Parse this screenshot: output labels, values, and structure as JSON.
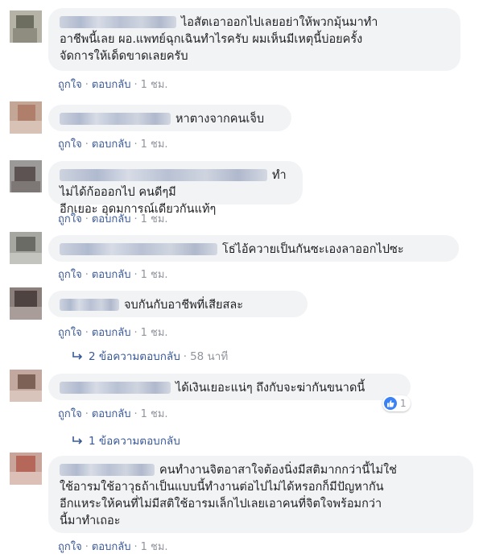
{
  "actions": {
    "like": "ถูกใจ",
    "reply": "ตอบกลับ",
    "separator": "·"
  },
  "comments": [
    {
      "text": "ไอสัตเอาออกไปเลยอย่าให้พวกมุ้นมาทำ\nอาชีพนี้เลย ผอ.แพทย์ฉุกเฉินทำไรครับ ผมเห็นมีเหตุนี้บ่อยครั้ง\nจัดการให้เด็ดขาดเลยครับ",
      "time": "1 ชม."
    },
    {
      "text": "หาตางจากคนเจ็บ",
      "time": "1 ชม."
    },
    {
      "text": "ทำไม่ได้ก้อออกไป คนดีๆมี\nอีกเยอะ อุดมการณ์เดียวกันแท้ๆ",
      "time": "1 ชม."
    },
    {
      "text": "โธ่ไอ้ควายเป็นกันซะเองลาออกไปซะ",
      "time": "1 ชม."
    },
    {
      "text": "จบกันกับอาชีพที่เสียสละ",
      "time": "1 ชม.",
      "replies": "2 ข้อความตอบกลับ",
      "replies_time": "58 นาที"
    },
    {
      "text": "ได้เงินเยอะแน่ๆ ถึงกับจะฆ่ากันขนาดนี้",
      "time": "1 ชม.",
      "replies": "1 ข้อความตอบกลับ",
      "reaction_count": "1"
    },
    {
      "text": "คนทำงานจิตอาสาใจต้องนิ่งมีสติมากกว่านี้ไม่ใช่\nใช้อารมใช้อาวุธถ้าเป็นแบบนี้ทำงานต่อไปไม่ได้หรอกก็มีปัญหากัน\nอีกแหระให้คนที่ไม่มีสติใช้อารมเล็กไปเลยเอาคนที่จิตใจพร้อมกว่า\nนี้มาทำเถอะ",
      "time": "1 ชม."
    }
  ]
}
